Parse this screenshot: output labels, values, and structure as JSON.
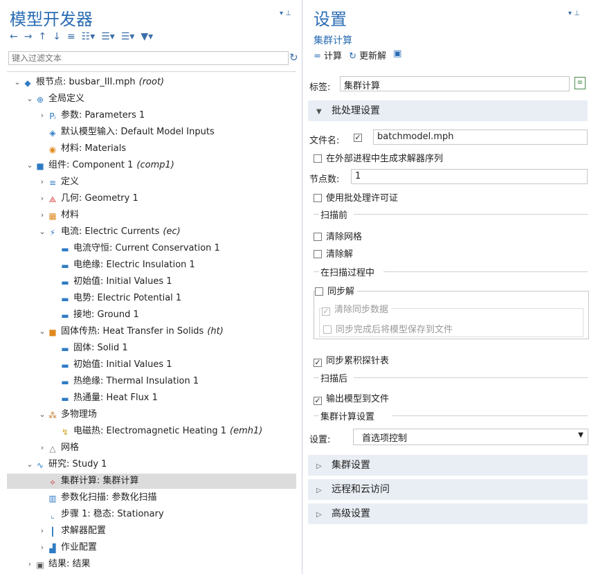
{
  "left": {
    "title": "模型开发器",
    "filter_placeholder": "键入过滤文本",
    "tree": [
      {
        "label": "根节点: busbar_III.mph",
        "suffix": "(root)",
        "icon": "root-icon",
        "toggle": "down",
        "depth": 0
      },
      {
        "label": "全局定义",
        "icon": "globe-icon",
        "toggle": "down",
        "depth": 1
      },
      {
        "label": "参数: Parameters 1",
        "icon": "param-icon",
        "toggle": "right",
        "depth": 2
      },
      {
        "label": "默认模型输入: Default Model Inputs",
        "icon": "inputs-icon",
        "toggle": "",
        "depth": 2
      },
      {
        "label": "材料: Materials",
        "icon": "material-icon",
        "toggle": "",
        "depth": 2
      },
      {
        "label": "组件: Component 1",
        "suffix": "(comp1)",
        "icon": "component-icon",
        "toggle": "down",
        "depth": 1
      },
      {
        "label": "定义",
        "icon": "definitions-icon",
        "toggle": "right",
        "depth": 2
      },
      {
        "label": "几何: Geometry 1",
        "icon": "geometry-icon",
        "toggle": "right",
        "depth": 2
      },
      {
        "label": "材料",
        "icon": "materials-icon",
        "toggle": "right",
        "depth": 2
      },
      {
        "label": "电流: Electric Currents",
        "suffix": "(ec)",
        "icon": "physics-icon",
        "toggle": "down",
        "depth": 2
      },
      {
        "label": "电流守恒: Current Conservation 1",
        "icon": "domain-d-icon",
        "toggle": "",
        "depth": 3
      },
      {
        "label": "电绝缘: Electric Insulation 1",
        "icon": "domain-d-icon",
        "toggle": "",
        "depth": 3
      },
      {
        "label": "初始值: Initial Values 1",
        "icon": "domain-d-icon",
        "toggle": "",
        "depth": 3
      },
      {
        "label": "电势: Electric Potential 1",
        "icon": "boundary-icon",
        "toggle": "",
        "depth": 3
      },
      {
        "label": "接地: Ground 1",
        "icon": "boundary-icon",
        "toggle": "",
        "depth": 3
      },
      {
        "label": "固体传热: Heat Transfer in Solids",
        "suffix": "(ht)",
        "icon": "heat-icon",
        "toggle": "down",
        "depth": 2
      },
      {
        "label": "固体: Solid 1",
        "icon": "domain-d-icon",
        "toggle": "",
        "depth": 3
      },
      {
        "label": "初始值: Initial Values 1",
        "icon": "domain-d-icon",
        "toggle": "",
        "depth": 3
      },
      {
        "label": "热绝缘: Thermal Insulation 1",
        "icon": "domain-d-icon",
        "toggle": "",
        "depth": 3
      },
      {
        "label": "热通量: Heat Flux 1",
        "icon": "boundary-icon",
        "toggle": "",
        "depth": 3
      },
      {
        "label": "多物理场",
        "icon": "multiphysics-icon",
        "toggle": "down",
        "depth": 2
      },
      {
        "label": "电磁热: Electromagnetic Heating 1",
        "suffix": "(emh1)",
        "icon": "coupling-icon",
        "toggle": "",
        "depth": 3
      },
      {
        "label": "网格",
        "icon": "mesh-icon",
        "toggle": "right",
        "depth": 2
      },
      {
        "label": "研究: Study 1",
        "icon": "study-icon",
        "toggle": "down",
        "depth": 1
      },
      {
        "label": "集群计算: 集群计算",
        "icon": "cluster-icon",
        "toggle": "",
        "depth": 2,
        "selected": true
      },
      {
        "label": "参数化扫描: 参数化扫描",
        "icon": "sweep-icon",
        "toggle": "",
        "depth": 2
      },
      {
        "label": "步骤 1: 稳态: Stationary",
        "icon": "step-icon",
        "toggle": "",
        "depth": 2
      },
      {
        "label": "求解器配置",
        "icon": "solver-icon",
        "toggle": "right",
        "depth": 2
      },
      {
        "label": "作业配置",
        "icon": "job-icon",
        "toggle": "right",
        "depth": 2
      },
      {
        "label": "结果: 结果",
        "icon": "results-icon",
        "toggle": "right",
        "depth": 1
      }
    ]
  },
  "right": {
    "title": "设置",
    "subtitle": "集群计算",
    "compute_label": "计算",
    "update_label": "更新解",
    "tag_label": "标签:",
    "tag_value": "集群计算",
    "batch_section": "批处理设置",
    "filename_label": "文件名:",
    "filename_value": "batchmodel.mph",
    "gen_solver_seq": "在外部进程中生成求解器序列",
    "nodes_label": "节点数:",
    "nodes_value": "1",
    "batch_license": "使用批处理许可证",
    "before_sweep": "扫描前",
    "clear_mesh": "清除网格",
    "clear_solution": "清除解",
    "during_sweep": "在扫描过程中",
    "sync_solution": "同步解",
    "clear_sync_data": "清除同步数据",
    "save_on_sync": "同步完成后将模型保存到文件",
    "sync_probe": "同步累积探针表",
    "after_sweep": "扫描后",
    "export_model": "输出模型到文件",
    "cluster_compute_settings": "集群计算设置",
    "settings_label": "设置:",
    "settings_value": "首选项控制",
    "cluster_section": "集群设置",
    "remote_section": "远程和云访问",
    "advanced_section": "高级设置"
  }
}
